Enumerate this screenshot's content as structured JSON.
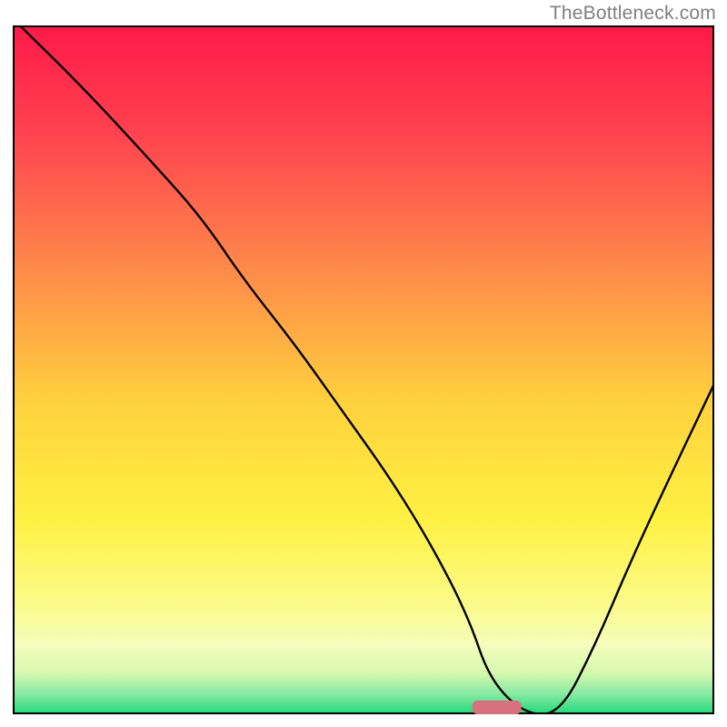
{
  "watermark": "TheBottleneck.com",
  "chart_data": {
    "type": "line",
    "title": "",
    "xlabel": "",
    "ylabel": "",
    "xlim": [
      0,
      100
    ],
    "ylim": [
      0,
      100
    ],
    "grid": false,
    "legend": false,
    "background_gradient_stops": [
      {
        "offset": 0.0,
        "color": "#ff1a48"
      },
      {
        "offset": 0.15,
        "color": "#ff404f"
      },
      {
        "offset": 0.35,
        "color": "#ff884a"
      },
      {
        "offset": 0.55,
        "color": "#ffd23d"
      },
      {
        "offset": 0.72,
        "color": "#fff143"
      },
      {
        "offset": 0.84,
        "color": "#fbfb89"
      },
      {
        "offset": 0.9,
        "color": "#f4fdbc"
      },
      {
        "offset": 0.94,
        "color": "#d6f8af"
      },
      {
        "offset": 0.97,
        "color": "#88eaa3"
      },
      {
        "offset": 1.0,
        "color": "#1fd97a"
      }
    ],
    "marker": {
      "shape": "rounded-rect",
      "color": "#d6717d",
      "x": 69,
      "y": 1,
      "width": 7,
      "height": 2
    },
    "series": [
      {
        "name": "curve",
        "color": "#000000",
        "x": [
          1,
          10,
          20,
          27,
          33,
          40,
          47,
          54,
          60,
          65,
          68,
          73,
          78,
          83,
          88,
          93,
          100
        ],
        "y": [
          100,
          91,
          80,
          72,
          63,
          54,
          44,
          34,
          24,
          14,
          5,
          0,
          0,
          10,
          22,
          33,
          48
        ]
      }
    ],
    "annotations": []
  }
}
